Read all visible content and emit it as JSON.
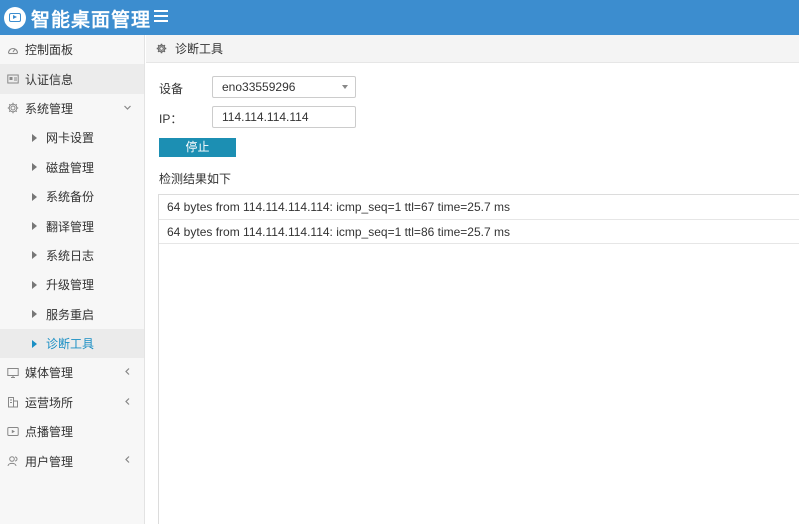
{
  "app": {
    "title": "智能桌面管理"
  },
  "sidebar": {
    "items": [
      {
        "label": "控制面板",
        "icon": "dashboard-icon"
      },
      {
        "label": "认证信息",
        "icon": "id-card-icon"
      },
      {
        "label": "系统管理",
        "icon": "gear-icon",
        "chevron": "down"
      },
      {
        "label": "媒体管理",
        "icon": "monitor-icon",
        "chevron": "left"
      },
      {
        "label": "运营场所",
        "icon": "building-icon",
        "chevron": "left"
      },
      {
        "label": "点播管理",
        "icon": "play-icon"
      },
      {
        "label": "用户管理",
        "icon": "users-icon",
        "chevron": "left"
      }
    ],
    "system_sub_items": [
      {
        "label": "网卡设置"
      },
      {
        "label": "磁盘管理"
      },
      {
        "label": "系统备份"
      },
      {
        "label": "翻译管理"
      },
      {
        "label": "系统日志"
      },
      {
        "label": "升级管理"
      },
      {
        "label": "服务重启"
      },
      {
        "label": "诊断工具",
        "current": true
      }
    ]
  },
  "breadcrumb": {
    "label": "诊断工具",
    "icon": "gear-icon"
  },
  "form": {
    "device_label": "设备",
    "device_value": "eno33559296",
    "ip_label": "IP：",
    "ip_value": "114.114.114.114",
    "stop_button": "停止",
    "results_title": "检测结果如下"
  },
  "results": [
    "64 bytes from 114.114.114.114: icmp_seq=1 ttl=67 time=25.7 ms",
    "64 bytes from 114.114.114.114: icmp_seq=1 ttl=86 time=25.7 ms"
  ],
  "colors": {
    "header_bg": "#3c8dcf",
    "button_bg": "#1c8fb3",
    "active_text": "#1a8fc4"
  }
}
